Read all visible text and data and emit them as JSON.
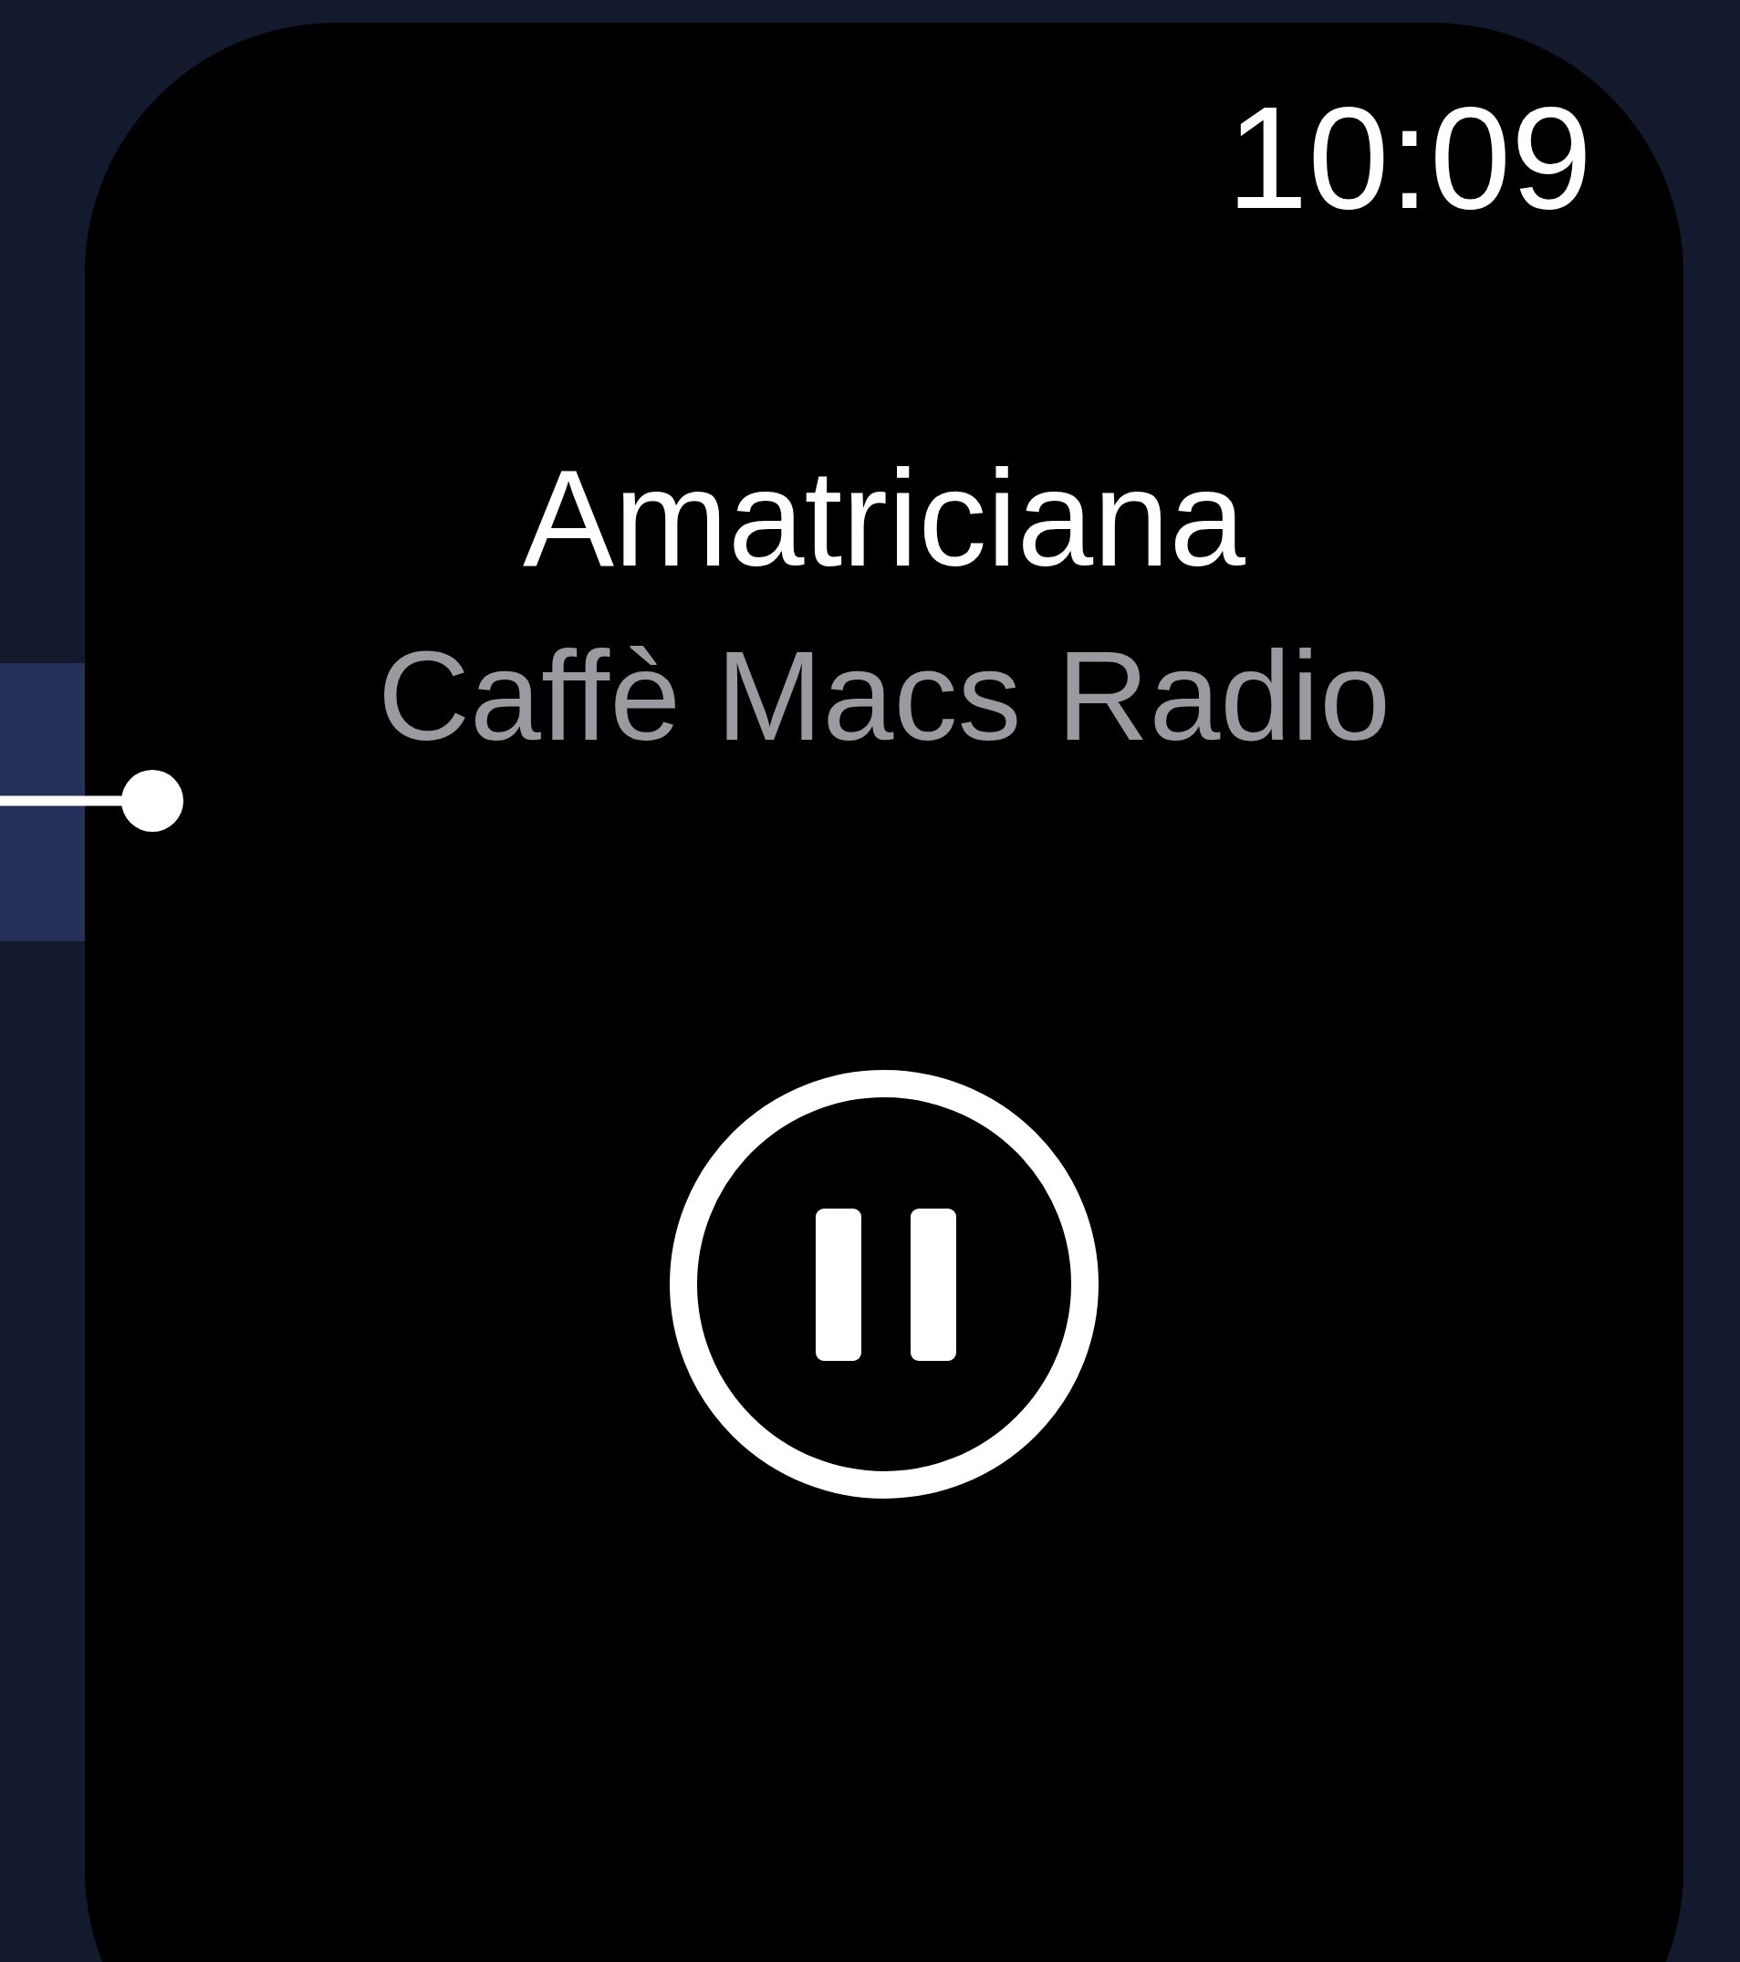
{
  "status": {
    "time": "10:09"
  },
  "now_playing": {
    "title": "Amatriciana",
    "station": "Caffè Macs Radio",
    "playing": true
  }
}
